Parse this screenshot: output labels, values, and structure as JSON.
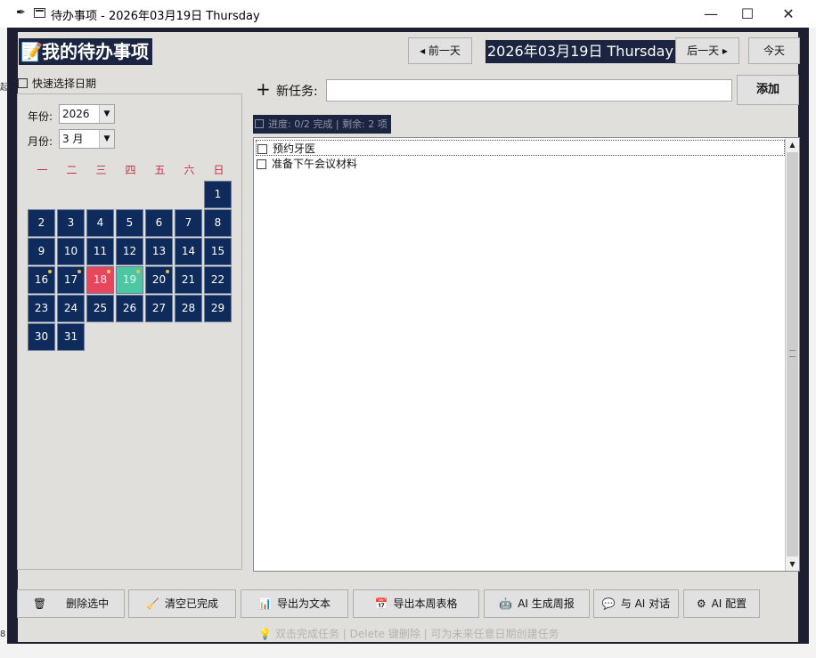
{
  "window": {
    "title": "待办事项 - 2026年03月19日 Thursday",
    "controls": {
      "minimize": "—",
      "maximize": "☐",
      "close": "✕"
    }
  },
  "header": {
    "title": "我的待办事项",
    "icon": "memo-icon",
    "prev_day": "◂ 前一天",
    "current_date": "2026年03月19日 Thursday",
    "next_day": "后一天 ▸",
    "today": "今天"
  },
  "left_edge_fragments": {
    "top": "起",
    "bottom": "8"
  },
  "quick_select": {
    "label": "快速选择日期",
    "year_label": "年份:",
    "year_value": "2026",
    "month_label": "月份:",
    "month_value": "3 月"
  },
  "calendar": {
    "weekdays": [
      "一",
      "二",
      "三",
      "四",
      "五",
      "六",
      "日"
    ],
    "days": [
      "1",
      "2",
      "3",
      "4",
      "5",
      "6",
      "7",
      "8",
      "9",
      "10",
      "11",
      "12",
      "13",
      "14",
      "15",
      "16",
      "17",
      "18",
      "19",
      "20",
      "21",
      "22",
      "23",
      "24",
      "25",
      "26",
      "27",
      "28",
      "29",
      "30",
      "31"
    ],
    "days_with_tasks": [
      "16",
      "17",
      "18",
      "19",
      "20"
    ],
    "selected_day": "18",
    "today": "19",
    "colors": {
      "day": "#0f2b5c",
      "selected": "#e8465c",
      "today": "#4cc8a0",
      "weekday": "#c0304a"
    }
  },
  "new_task": {
    "label": "新任务:",
    "value": "",
    "add_button": "添加"
  },
  "progress": {
    "text": "进度: 0/2 完成 | 剩余: 2 项"
  },
  "tasks": [
    {
      "text": "预约牙医",
      "done": false
    },
    {
      "text": "准备下午会议材料",
      "done": false
    }
  ],
  "toolbar": {
    "delete": "删除选中",
    "clear_done": "清空已完成",
    "export_text": "导出为文本",
    "export_week": "导出本周表格",
    "ai_report": "AI 生成周报",
    "ai_chat": "与 AI 对话",
    "ai_config": "AI 配置"
  },
  "hint": "双击完成任务 | Delete 键删除 | 可为未来任意日期创建任务"
}
